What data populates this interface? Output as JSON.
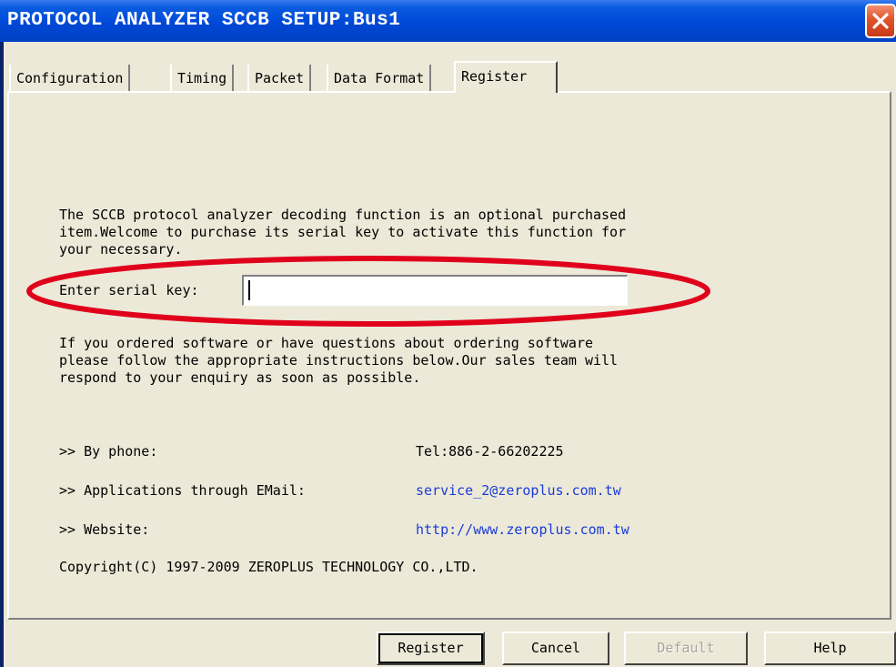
{
  "window": {
    "title": "PROTOCOL ANALYZER SCCB SETUP:Bus1"
  },
  "tabs": [
    {
      "label": "Configuration",
      "active": false
    },
    {
      "label": "Timing",
      "active": false
    },
    {
      "label": "Packet",
      "active": false
    },
    {
      "label": "Data Format",
      "active": false
    },
    {
      "label": "Register",
      "active": true
    }
  ],
  "register": {
    "intro_text": "The SCCB protocol analyzer decoding function is an optional purchased\nitem.Welcome to purchase its serial key to activate this function for\nyour necessary.",
    "serial_key_label": "Enter serial key:",
    "serial_key_value": "",
    "order_text": "If you ordered software or have questions about ordering software\nplease follow the appropriate instructions below.Our sales team will\nrespond to your enquiry as soon as possible.",
    "contacts": [
      {
        "label": ">> By phone:",
        "value": "Tel:886-2-66202225"
      },
      {
        "label": ">> Applications through EMail:",
        "value": "service_2@zeroplus.com.tw"
      },
      {
        "label": ">> Website:",
        "value": "http://www.zeroplus.com.tw"
      }
    ],
    "copyright": "Copyright(C) 1997-2009 ZEROPLUS TECHNOLOGY CO.,LTD."
  },
  "buttons": {
    "register": "Register",
    "cancel": "Cancel",
    "default": "Default",
    "help": "Help"
  },
  "colors": {
    "titlebar": "#0048d8",
    "dialog_bg": "#ece9d8",
    "link": "#1a3cd8",
    "highlight_ellipse": "#e0001b"
  }
}
